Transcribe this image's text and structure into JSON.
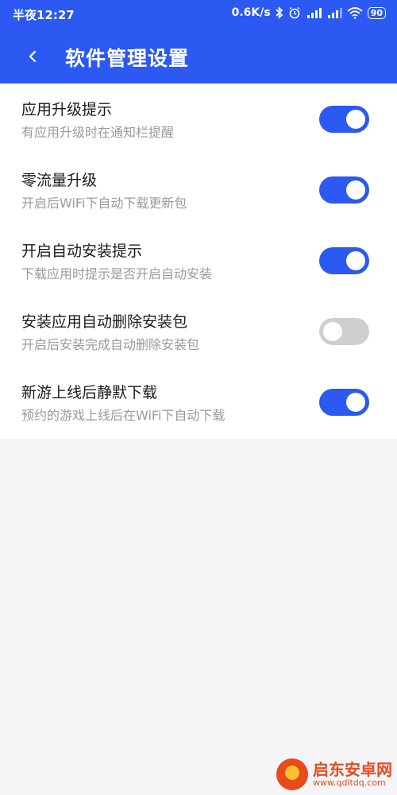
{
  "status_bar": {
    "time": "半夜12:27",
    "speed": "0.6K/s",
    "battery": "90",
    "icons": [
      "bluetooth-icon",
      "alarm-icon",
      "signal-hd-icon",
      "signal-icon",
      "wifi-icon"
    ]
  },
  "header": {
    "back_icon": "chevron-left-icon",
    "title": "软件管理设置"
  },
  "settings": [
    {
      "title": "应用升级提示",
      "subtitle": "有应用升级时在通知栏提醒",
      "enabled": true
    },
    {
      "title": "零流量升级",
      "subtitle": "开启后WiFi下自动下载更新包",
      "enabled": true
    },
    {
      "title": "开启自动安装提示",
      "subtitle": "下载应用时提示是否开启自动安装",
      "enabled": true
    },
    {
      "title": "安装应用自动删除安装包",
      "subtitle": "开启后安装完成自动删除安装包",
      "enabled": false
    },
    {
      "title": "新游上线后静默下载",
      "subtitle": "预约的游戏上线后在WiFi下自动下载",
      "enabled": true
    }
  ],
  "watermark": {
    "name": "启东安卓网",
    "url": "www.qdltdq.com"
  },
  "colors": {
    "accent": "#2b59f2",
    "toggle_off": "#cfcfcf",
    "watermark": "#e94a1c"
  }
}
